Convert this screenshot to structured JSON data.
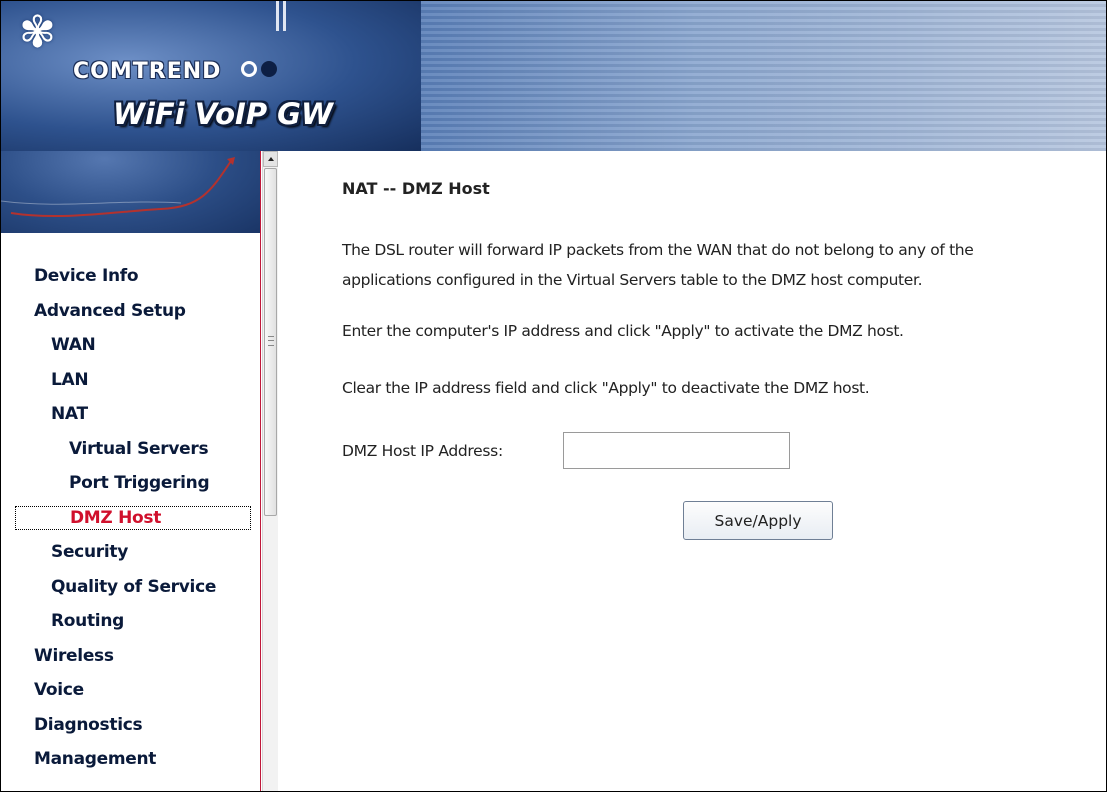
{
  "banner": {
    "brand": "COMTREND",
    "product": "WiFi VoIP GW"
  },
  "sidebar": {
    "items": [
      {
        "label": "Device Info",
        "level": 0
      },
      {
        "label": "Advanced Setup",
        "level": 0
      },
      {
        "label": "WAN",
        "level": 1
      },
      {
        "label": "LAN",
        "level": 1
      },
      {
        "label": "NAT",
        "level": 1
      },
      {
        "label": "Virtual Servers",
        "level": 2
      },
      {
        "label": "Port Triggering",
        "level": 2
      },
      {
        "label": "DMZ Host",
        "level": 2,
        "active": true
      },
      {
        "label": "Security",
        "level": 1
      },
      {
        "label": "Quality of Service",
        "level": 1
      },
      {
        "label": "Routing",
        "level": 1
      },
      {
        "label": "Wireless",
        "level": 0
      },
      {
        "label": "Voice",
        "level": 0
      },
      {
        "label": "Diagnostics",
        "level": 0
      },
      {
        "label": "Management",
        "level": 0
      }
    ]
  },
  "main": {
    "title": "NAT -- DMZ Host",
    "description_line1": "The DSL router will forward IP packets from the WAN that do not belong to any of the",
    "description_line2": "applications configured in the Virtual Servers table to the DMZ host computer.",
    "hint_activate": "Enter the computer's IP address and click \"Apply\" to activate the DMZ host.",
    "hint_deactivate": "Clear the IP address field and click \"Apply\" to deactivate the DMZ host.",
    "ip_label": "DMZ Host IP Address:",
    "ip_value": "",
    "apply_label": "Save/Apply"
  },
  "colors": {
    "active_menu": "#d0102c",
    "menu_text": "#0a1a3a",
    "sidebar_border": "#c0183a"
  }
}
